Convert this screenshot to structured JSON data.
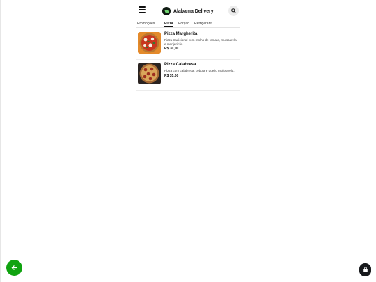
{
  "header": {
    "brand_name": "Alabama Delivery",
    "menu_icon": "hamburger-menu-icon",
    "search_icon": "search-icon",
    "logo_icon": "leaf-logo-icon"
  },
  "tabs": [
    {
      "label": "Promoções",
      "active": false
    },
    {
      "label": "Pizza",
      "active": true
    },
    {
      "label": "Porção",
      "active": false
    },
    {
      "label": "Refrigerant",
      "active": false
    }
  ],
  "products": [
    {
      "name": "Pizza Margherita",
      "description": "Pizza tradicional com molho de tomate, muissarela e manjericão.",
      "price": "R$ 30,00"
    },
    {
      "name": "Pizza Calabresa",
      "description": "Pizza com calabresa, cebola e queijo muissarela.",
      "price": "R$ 35,00"
    }
  ],
  "footer": {
    "back_icon": "arrow-left-icon",
    "cart_icon": "shopping-bag-icon",
    "accent_color": "#10a310",
    "cart_color": "#17191c"
  }
}
